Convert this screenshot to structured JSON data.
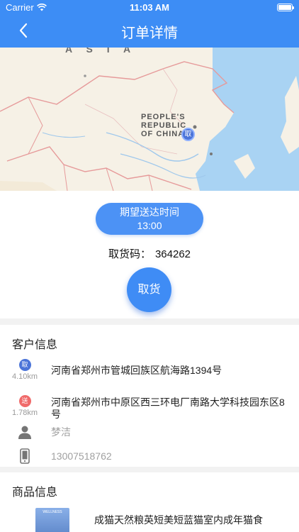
{
  "status": {
    "carrier": "Carrier",
    "time": "11:03 AM"
  },
  "nav": {
    "title": "订单详情"
  },
  "map": {
    "region_label": "A S I A",
    "country_label_1": "PEOPLE'S",
    "country_label_2": "REPUBLIC",
    "country_label_3": "OF CHINA",
    "pin_label": "取"
  },
  "order": {
    "expect_label": "期望送达时间",
    "expect_time": "13:00",
    "pickup_code_label": "取货码：",
    "pickup_code": "364262",
    "pickup_button": "取货"
  },
  "customer": {
    "section_title": "客户信息",
    "pickup": {
      "badge": "取",
      "distance": "4.10km",
      "address": "河南省郑州市管城回族区航海路1394号"
    },
    "delivery": {
      "badge": "送",
      "distance": "1.78km",
      "address": "河南省郑州市中原区西三环电厂南路大学科技园东区8号"
    },
    "name": "梦洁",
    "phone": "13007518762"
  },
  "goods": {
    "section_title": "商品信息",
    "thumb_text": "WELLNESS",
    "product_name": "成猫天然粮英短美短蓝猫室内成年猫食"
  },
  "colors": {
    "primary": "#3d8df5",
    "pickup_badge": "#4b74d8",
    "delivery_badge": "#f06a6a"
  }
}
